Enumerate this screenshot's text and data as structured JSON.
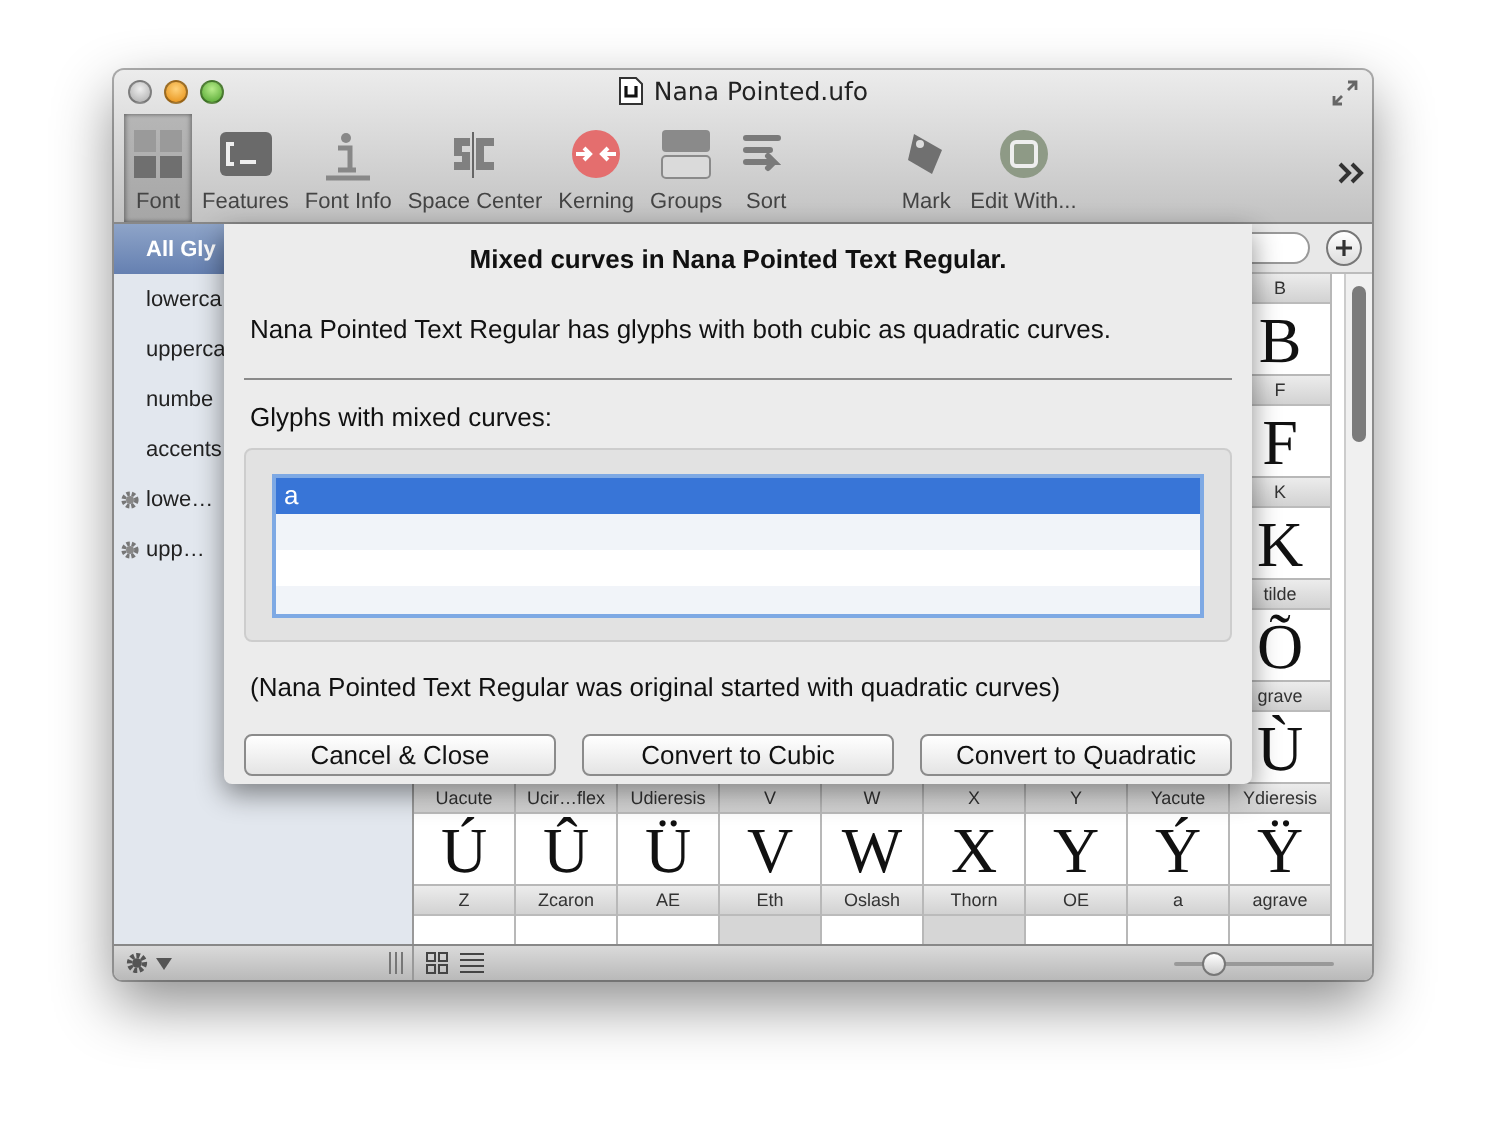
{
  "window": {
    "title": "Nana Pointed.ufo"
  },
  "toolbar": {
    "items": [
      {
        "label": "Font",
        "selected": true
      },
      {
        "label": "Features",
        "selected": false
      },
      {
        "label": "Font Info",
        "selected": false
      },
      {
        "label": "Space Center",
        "selected": false
      },
      {
        "label": "Kerning",
        "selected": false
      },
      {
        "label": "Groups",
        "selected": false
      },
      {
        "label": "Sort",
        "selected": false
      },
      {
        "label": "Mark",
        "selected": false
      },
      {
        "label": "Edit With...",
        "selected": false
      }
    ]
  },
  "sidebar": {
    "items": [
      {
        "label": "All Gly",
        "kind": "group",
        "selected": true
      },
      {
        "label": "lowerca",
        "kind": "group",
        "selected": false
      },
      {
        "label": "upperca",
        "kind": "group",
        "selected": false
      },
      {
        "label": "numbe",
        "kind": "group",
        "selected": false
      },
      {
        "label": "accents",
        "kind": "group",
        "selected": false
      },
      {
        "label": "lowe…",
        "kind": "smart",
        "selected": false
      },
      {
        "label": "upp…",
        "kind": "smart",
        "selected": false
      }
    ]
  },
  "glyph_grid": {
    "rows": [
      {
        "cells": [
          {
            "name": "B",
            "glyph": "B",
            "template": false
          }
        ]
      },
      {
        "cells": [
          {
            "name": "F",
            "glyph": "F",
            "template": false
          }
        ]
      },
      {
        "cells": [
          {
            "name": "K",
            "glyph": "K",
            "template": false
          }
        ]
      },
      {
        "cells": [
          {
            "name": "tilde",
            "glyph": "Õ",
            "template": false
          }
        ]
      },
      {
        "cells": [
          {
            "name": "grave",
            "glyph": "Ù",
            "template": false
          }
        ]
      },
      {
        "cells": [
          {
            "name": "Uacute",
            "glyph": "Ú",
            "template": false
          },
          {
            "name": "Ucir…flex",
            "glyph": "Û",
            "template": false
          },
          {
            "name": "Udieresis",
            "glyph": "Ü",
            "template": false
          },
          {
            "name": "V",
            "glyph": "V",
            "template": false
          },
          {
            "name": "W",
            "glyph": "W",
            "template": false
          },
          {
            "name": "X",
            "glyph": "X",
            "template": false
          },
          {
            "name": "Y",
            "glyph": "Y",
            "template": false
          },
          {
            "name": "Yacute",
            "glyph": "Ý",
            "template": false
          },
          {
            "name": "Ydieresis",
            "glyph": "Ÿ",
            "template": false
          }
        ]
      },
      {
        "cells": [
          {
            "name": "Z",
            "template": false
          },
          {
            "name": "Zcaron",
            "template": false
          },
          {
            "name": "AE",
            "template": false
          },
          {
            "name": "Eth",
            "template": true
          },
          {
            "name": "Oslash",
            "template": false
          },
          {
            "name": "Thorn",
            "template": true
          },
          {
            "name": "OE",
            "template": false
          },
          {
            "name": "a",
            "template": false
          },
          {
            "name": "agrave",
            "template": false
          }
        ]
      }
    ]
  },
  "zoom_slider": {
    "level": 0.25
  },
  "sheet": {
    "title": "Mixed curves in Nana Pointed Text Regular.",
    "message": "Nana Pointed Text Regular has glyphs with both cubic as quadratic curves.",
    "list_label": "Glyphs with mixed curves:",
    "glyphs": [
      {
        "name": "a",
        "selected": true
      }
    ],
    "note": "(Nana Pointed Text Regular was original started with quadratic curves)",
    "buttons": [
      "Cancel & Close",
      "Convert to Cubic",
      "Convert to Quadratic"
    ]
  }
}
